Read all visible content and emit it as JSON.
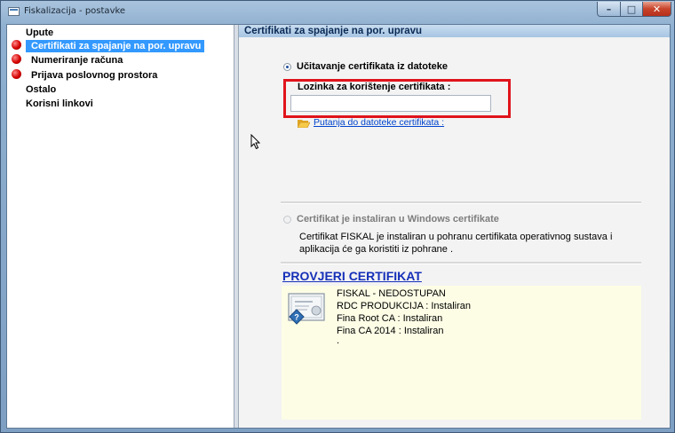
{
  "window": {
    "title": "Fiskalizacija - postavke",
    "controls": {
      "minimize": "–",
      "maximize": "□",
      "close": "✕"
    }
  },
  "tree": {
    "items": [
      {
        "label": "Upute",
        "status": "none",
        "selected": false
      },
      {
        "label": "Certifikati za spajanje na por. upravu",
        "status": "error",
        "selected": true
      },
      {
        "label": "Numeriranje računa",
        "status": "error",
        "selected": false
      },
      {
        "label": "Prijava poslovnog prostora",
        "status": "error",
        "selected": false
      },
      {
        "label": "Ostalo",
        "status": "none",
        "selected": false
      },
      {
        "label": "Korisni linkovi",
        "status": "none",
        "selected": false
      }
    ]
  },
  "panel": {
    "header": "Certifikati za spajanje na por. upravu",
    "option_file": {
      "label": "Učitavanje certifikata iz datoteke",
      "checked": true
    },
    "password_label": "Lozinka za korištenje certifikata :",
    "password_value": "",
    "file_path_link": "Putanja do datoteke certifikata :",
    "option_windows": {
      "label": "Certifikat je instaliran u Windows certifikate",
      "checked": false,
      "disabled": true
    },
    "windows_description": "Certifikat FISKAL je instaliran u pohranu certifikata operativnog sustava i aplikacija će ga koristiti iz pohrane .",
    "verify_link": "PROVJERI CERTIFIKAT",
    "status_lines": [
      "FISKAL - NEDOSTUPAN",
      "RDC PRODUKCIJA : Instaliran",
      "Fina  Root CA : Instaliran",
      "Fina  CA 2014 : Instaliran",
      "."
    ]
  },
  "colors": {
    "selection": "#3399ff",
    "error_dot": "#d40000",
    "highlight_frame": "#e0131b",
    "link": "#0044cc",
    "info_background": "#fdfde6"
  }
}
